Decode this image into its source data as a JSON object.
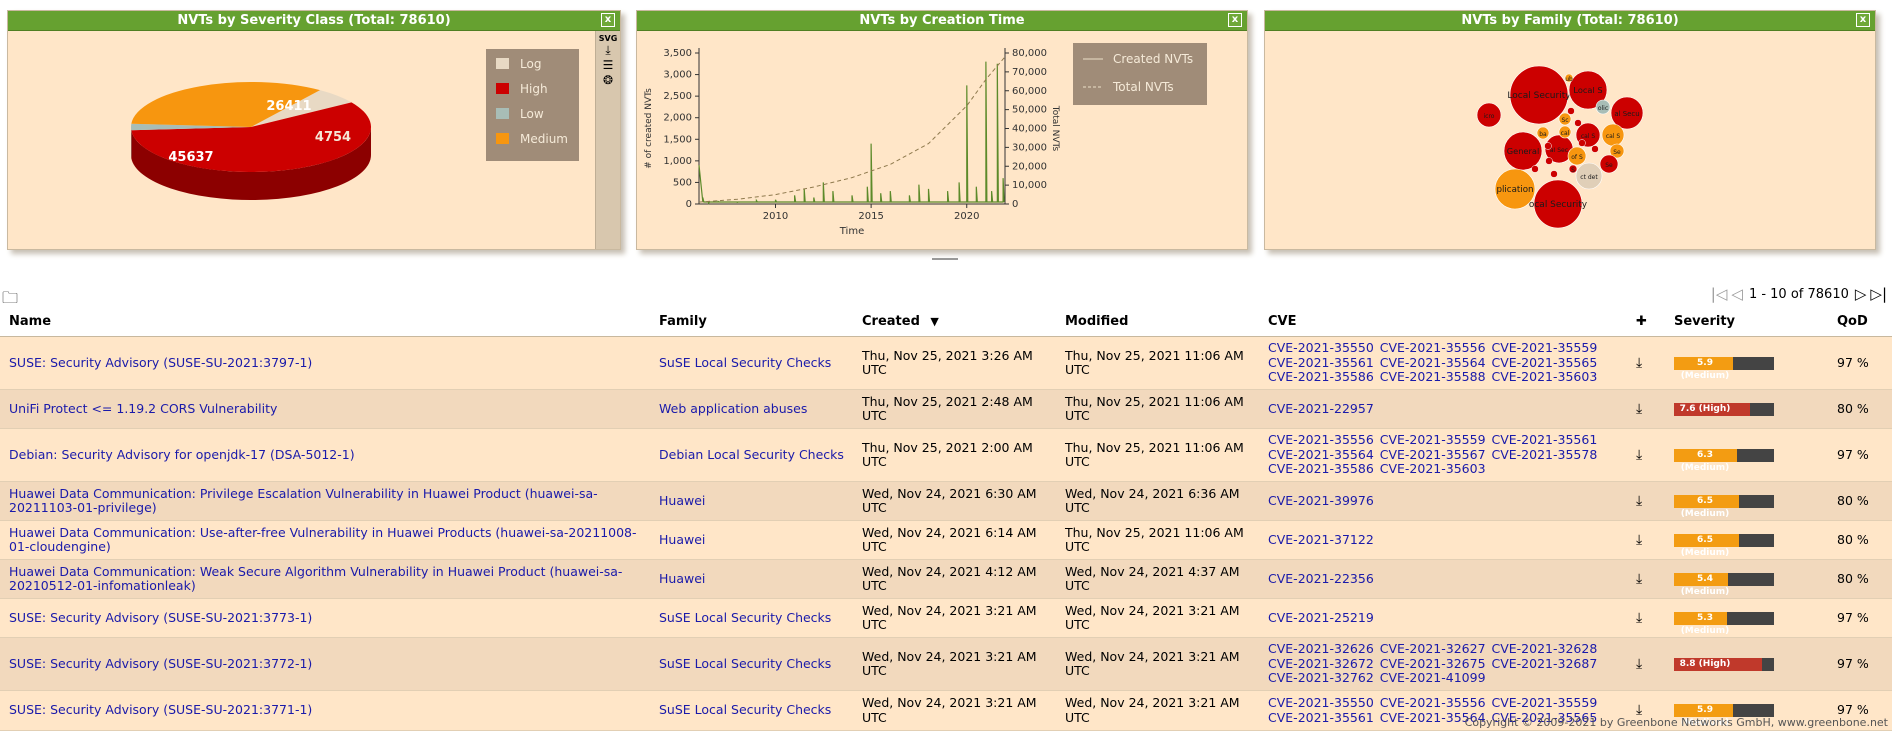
{
  "panels": {
    "severity": {
      "title": "NVTs by Severity Class (Total: 78610)",
      "close_label": "x",
      "svg_label": "SVG",
      "legend": [
        {
          "label": "Log",
          "color": "#e8d9c4"
        },
        {
          "label": "High",
          "color": "#cc0000"
        },
        {
          "label": "Low",
          "color": "#a8bdb6"
        },
        {
          "label": "Medium",
          "color": "#f7960f"
        }
      ]
    },
    "creation": {
      "title": "NVTs by Creation Time",
      "close_label": "x",
      "legend": [
        {
          "label": "Created NVTs"
        },
        {
          "label": "Total NVTs"
        }
      ]
    },
    "family": {
      "title": "NVTs by Family (Total: 78610)",
      "close_label": "x"
    }
  },
  "chart_data": [
    {
      "type": "pie",
      "title": "NVTs by Severity Class (Total: 78610)",
      "categories": [
        "Log",
        "High",
        "Low",
        "Medium"
      ],
      "values": [
        4754,
        45637,
        1808,
        26411
      ],
      "data_labels": [
        "45637",
        "26411",
        "4754"
      ],
      "legend_position": "top-right"
    },
    {
      "type": "line",
      "title": "NVTs by Creation Time",
      "xlabel": "Time",
      "ylabel": "# of created NVTs",
      "y2label": "Total NVTs",
      "xlim": [
        2006,
        2022
      ],
      "ylim": [
        0,
        3500
      ],
      "y2lim": [
        0,
        80000
      ],
      "x_ticks": [
        "2010",
        "2015",
        "2020"
      ],
      "y_ticks": [
        "0",
        "500",
        "1,000",
        "1,500",
        "2,000",
        "2,500",
        "3,000",
        "3,500"
      ],
      "y2_ticks": [
        "0",
        "10,000",
        "20,000",
        "30,000",
        "40,000",
        "50,000",
        "60,000",
        "70,000",
        "80,000"
      ],
      "series": [
        {
          "name": "Created NVTs",
          "x": [
            2006.0,
            2006.2,
            2006.5,
            2007,
            2008,
            2009,
            2010,
            2011,
            2011.5,
            2012,
            2012.5,
            2013,
            2014,
            2014.8,
            2015,
            2015.5,
            2016,
            2017,
            2017.5,
            2018,
            2019,
            2019.6,
            2020,
            2020.5,
            2021,
            2021.3,
            2021.6,
            2021.9
          ],
          "values": [
            900,
            150,
            20,
            60,
            40,
            80,
            100,
            200,
            350,
            150,
            500,
            300,
            200,
            400,
            1400,
            250,
            300,
            200,
            450,
            350,
            300,
            500,
            2750,
            400,
            3300,
            300,
            3250,
            600
          ]
        },
        {
          "name": "Total NVTs",
          "x": [
            2006,
            2008,
            2010,
            2012,
            2014,
            2016,
            2018,
            2020,
            2021,
            2022
          ],
          "values": [
            1000,
            2500,
            5000,
            9000,
            14000,
            21000,
            32000,
            52000,
            66000,
            78000
          ]
        }
      ],
      "legend_position": "top-right"
    },
    {
      "type": "bubble",
      "title": "NVTs by Family (Total: 78610)",
      "labels": [
        "Local Security",
        "Local S",
        "al Secu",
        "icro",
        "General",
        "al Sec",
        "plication",
        "ocal Security",
        "cal S",
        "ct det",
        "of S",
        "Se",
        "olic",
        "ba",
        "cal",
        "Sc",
        "S",
        "ub"
      ]
    }
  ],
  "table": {
    "folder_icon": "folder-icon",
    "pager": {
      "first": "|◁",
      "prev": "◁",
      "range": "1 - 10 of 78610",
      "next": "▷",
      "last": "▷|"
    },
    "headers": {
      "name": "Name",
      "family": "Family",
      "created": "Created",
      "sort_indicator": "▼",
      "modified": "Modified",
      "cve": "CVE",
      "solution_icon": "puzzle-piece-icon",
      "severity": "Severity",
      "qod": "QoD"
    },
    "rows": [
      {
        "name": "SUSE: Security Advisory (SUSE-SU-2021:3797-1)",
        "family": "SuSE Local Security Checks",
        "created": "Thu, Nov 25, 2021 3:26 AM UTC",
        "modified": "Thu, Nov 25, 2021 11:06 AM UTC",
        "cve": "CVE-2021-35550 CVE-2021-35556 CVE-2021-35559 CVE-2021-35561 CVE-2021-35564 CVE-2021-35565 CVE-2021-35586 CVE-2021-35588 CVE-2021-35603",
        "severity": "5.9 (Medium)",
        "score": 5.9,
        "sev_color": "#f39c12",
        "qod": "97 %"
      },
      {
        "name": "UniFi Protect <= 1.19.2 CORS Vulnerability",
        "family": "Web application abuses",
        "created": "Thu, Nov 25, 2021 2:48 AM UTC",
        "modified": "Thu, Nov 25, 2021 11:06 AM UTC",
        "cve": "CVE-2021-22957",
        "severity": "7.6 (High)",
        "score": 7.6,
        "sev_color": "#c0392b",
        "qod": "80 %"
      },
      {
        "name": "Debian: Security Advisory for openjdk-17 (DSA-5012-1)",
        "family": "Debian Local Security Checks",
        "created": "Thu, Nov 25, 2021 2:00 AM UTC",
        "modified": "Thu, Nov 25, 2021 11:06 AM UTC",
        "cve": "CVE-2021-35556 CVE-2021-35559 CVE-2021-35561 CVE-2021-35564 CVE-2021-35567 CVE-2021-35578 CVE-2021-35586 CVE-2021-35603",
        "severity": "6.3 (Medium)",
        "score": 6.3,
        "sev_color": "#f39c12",
        "qod": "97 %"
      },
      {
        "name": "Huawei Data Communication: Privilege Escalation Vulnerability in Huawei Product (huawei-sa-20211103-01-privilege)",
        "family": "Huawei",
        "created": "Wed, Nov 24, 2021 6:30 AM UTC",
        "modified": "Wed, Nov 24, 2021 6:36 AM UTC",
        "cve": "CVE-2021-39976",
        "severity": "6.5 (Medium)",
        "score": 6.5,
        "sev_color": "#f39c12",
        "qod": "80 %"
      },
      {
        "name": "Huawei Data Communication: Use-after-free Vulnerability in Huawei Products (huawei-sa-20211008-01-cloudengine)",
        "family": "Huawei",
        "created": "Wed, Nov 24, 2021 6:14 AM UTC",
        "modified": "Thu, Nov 25, 2021 11:06 AM UTC",
        "cve": "CVE-2021-37122",
        "severity": "6.5 (Medium)",
        "score": 6.5,
        "sev_color": "#f39c12",
        "qod": "80 %"
      },
      {
        "name": "Huawei Data Communication: Weak Secure Algorithm Vulnerability in Huawei Product (huawei-sa-20210512-01-infomationleak)",
        "family": "Huawei",
        "created": "Wed, Nov 24, 2021 4:12 AM UTC",
        "modified": "Wed, Nov 24, 2021 4:37 AM UTC",
        "cve": "CVE-2021-22356",
        "severity": "5.4 (Medium)",
        "score": 5.4,
        "sev_color": "#f39c12",
        "qod": "80 %"
      },
      {
        "name": "SUSE: Security Advisory (SUSE-SU-2021:3773-1)",
        "family": "SuSE Local Security Checks",
        "created": "Wed, Nov 24, 2021 3:21 AM UTC",
        "modified": "Wed, Nov 24, 2021 3:21 AM UTC",
        "cve": "CVE-2021-25219",
        "severity": "5.3 (Medium)",
        "score": 5.3,
        "sev_color": "#f39c12",
        "qod": "97 %"
      },
      {
        "name": "SUSE: Security Advisory (SUSE-SU-2021:3772-1)",
        "family": "SuSE Local Security Checks",
        "created": "Wed, Nov 24, 2021 3:21 AM UTC",
        "modified": "Wed, Nov 24, 2021 3:21 AM UTC",
        "cve": "CVE-2021-32626 CVE-2021-32627 CVE-2021-32628 CVE-2021-32672 CVE-2021-32675 CVE-2021-32687 CVE-2021-32762 CVE-2021-41099",
        "severity": "8.8 (High)",
        "score": 8.8,
        "sev_color": "#c0392b",
        "qod": "97 %"
      },
      {
        "name": "SUSE: Security Advisory (SUSE-SU-2021:3771-1)",
        "family": "SuSE Local Security Checks",
        "created": "Wed, Nov 24, 2021 3:21 AM UTC",
        "modified": "Wed, Nov 24, 2021 3:21 AM UTC",
        "cve": "CVE-2021-35550 CVE-2021-35556 CVE-2021-35559 CVE-2021-35561 CVE-2021-35564 CVE-2021-35565",
        "severity": "5.9 (Medium)",
        "score": 5.9,
        "sev_color": "#f39c12",
        "qod": "97 %"
      }
    ]
  },
  "footer": "Copyright © 2009-2021 by Greenbone Networks GmbH,  www.greenbone.net"
}
